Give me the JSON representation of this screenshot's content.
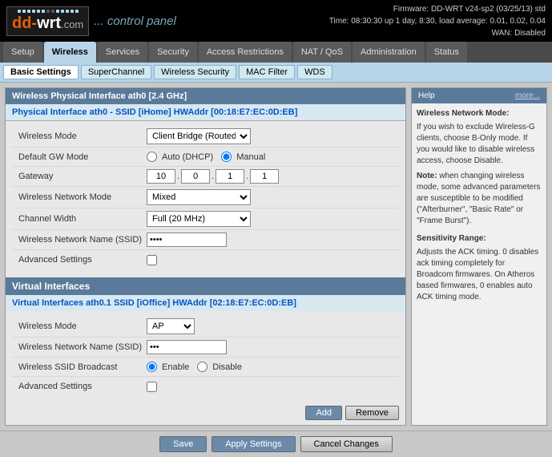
{
  "firmware": {
    "line1": "Firmware: DD-WRT v24-sp2 (03/25/13) std",
    "line2": "Time: 08:30:30 up 1 day, 8:30, load average: 0.01, 0.02, 0.04",
    "line3": "WAN: Disabled"
  },
  "logo": {
    "dd": "dd-",
    "wrt": "wrt",
    "com": ".com",
    "cp": "... control panel"
  },
  "main_nav": {
    "items": [
      {
        "label": "Setup",
        "active": false
      },
      {
        "label": "Wireless",
        "active": true
      },
      {
        "label": "Services",
        "active": false
      },
      {
        "label": "Security",
        "active": false
      },
      {
        "label": "Access Restrictions",
        "active": false
      },
      {
        "label": "NAT / QoS",
        "active": false
      },
      {
        "label": "Administration",
        "active": false
      },
      {
        "label": "Status",
        "active": false
      }
    ]
  },
  "sub_nav": {
    "items": [
      {
        "label": "Basic Settings",
        "active": true
      },
      {
        "label": "SuperChannel",
        "active": false
      },
      {
        "label": "Wireless Security",
        "active": false
      },
      {
        "label": "MAC Filter",
        "active": false
      },
      {
        "label": "WDS",
        "active": false
      }
    ]
  },
  "section_title": "Wireless Physical Interface ath0 [2.4 GHz]",
  "physical_interface": {
    "title": "Physical Interface ath0 - SSID [iHome] HWAddr [00:18:E7:EC:0D:EB]",
    "rows": [
      {
        "label": "Wireless Mode",
        "type": "select",
        "value": "Client Bridge (Routed)"
      },
      {
        "label": "Default GW Mode",
        "type": "radio",
        "options": [
          "Auto (DHCP)",
          "Manual"
        ],
        "selected": "Manual"
      },
      {
        "label": "Gateway",
        "type": "ip",
        "value": [
          "10",
          "0",
          "1",
          "1"
        ]
      },
      {
        "label": "Wireless Network Mode",
        "type": "select",
        "value": "Mixed"
      },
      {
        "label": "Channel Width",
        "type": "select",
        "value": "Full (20 MHz)"
      },
      {
        "label": "Wireless Network Name (SSID)",
        "type": "ssid",
        "value": "***"
      },
      {
        "label": "Advanced Settings",
        "type": "checkbox"
      }
    ]
  },
  "virtual_section": {
    "header": "Virtual Interfaces",
    "interface_title": "Virtual Interfaces ath0.1 SSID [iOffice] HWAddr [02:18:E7:EC:0D:EB]",
    "rows": [
      {
        "label": "Wireless Mode",
        "type": "select",
        "value": "AP"
      },
      {
        "label": "Wireless Network Name (SSID)",
        "type": "ssid",
        "value": "***"
      },
      {
        "label": "Wireless SSID Broadcast",
        "type": "radio_enable",
        "options": [
          "Enable",
          "Disable"
        ],
        "selected": "Enable"
      },
      {
        "label": "Advanced Settings",
        "type": "checkbox"
      }
    ]
  },
  "buttons": {
    "add": "Add",
    "remove": "Remove",
    "save": "Save",
    "apply": "Apply Settings",
    "cancel": "Cancel Changes"
  },
  "help": {
    "title": "Help",
    "more": "more...",
    "wireless_network_mode_label": "Wireless Network Mode:",
    "wireless_network_mode_text": "If you wish to exclude Wireless-G clients, choose B-Only mode. If you would like to disable wireless access, choose Disable.",
    "note_label": "Note:",
    "note_text": " when changing wireless mode, some advanced parameters are susceptible to be modified (\"Afterburner\", \"Basic Rate\" or \"Frame Burst\").",
    "sensitivity_label": "Sensitivity Range:",
    "sensitivity_text": "Adjusts the ACK timing. 0 disables ack timing completely for Broadcom firmwares. On Atheros based firmwares, 0 enables auto ACK timing mode."
  }
}
